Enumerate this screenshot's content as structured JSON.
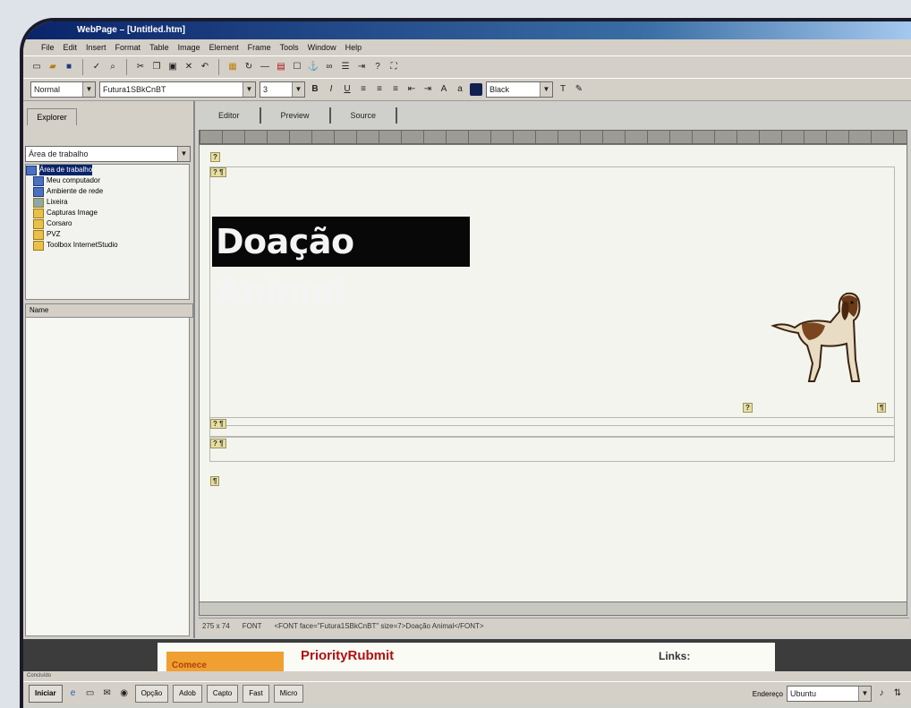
{
  "window": {
    "title": "WebPage – [Untitled.htm]"
  },
  "menu": [
    "File",
    "Edit",
    "Insert",
    "Format",
    "Table",
    "Image",
    "Element",
    "Frame",
    "Tools",
    "Window",
    "Help"
  ],
  "format_bar": {
    "style": "Normal",
    "font": "Futura1SBkCnBT",
    "size": "3",
    "color": "Black"
  },
  "explorer": {
    "tab_label": "Explorer",
    "folder_selected": "Área de trabalho",
    "tree": [
      {
        "label": "Área de trabalho",
        "selected": true,
        "icon": "desktop-icon"
      },
      {
        "label": "Meu computador",
        "icon": "computer-icon"
      },
      {
        "label": "Ambiente de rede",
        "icon": "network-icon"
      },
      {
        "label": "Lixeira",
        "icon": "recycle-bin-icon"
      },
      {
        "label": "Capturas Image",
        "icon": "folder-icon"
      },
      {
        "label": "Corsaro",
        "icon": "folder-icon"
      },
      {
        "label": "PVZ",
        "icon": "folder-icon"
      },
      {
        "label": "Toolbox InternetStudio",
        "icon": "folder-icon"
      }
    ],
    "name_header": "Name"
  },
  "view_tabs": [
    "Editor",
    "Preview",
    "Source"
  ],
  "page": {
    "headline": "Doação Animal",
    "marks": [
      "?",
      "? ¶",
      "?",
      "¶",
      "? ¶",
      "? ¶",
      "¶"
    ]
  },
  "status": {
    "size": "275 x 74",
    "tag": "FONT",
    "detail": "<FONT face=\"Futura1SBkCnBT\" size=7>Doação Animal</FONT>"
  },
  "browser": {
    "orange_text": "Comece",
    "title": "PriorityRubmit",
    "links": "Links:",
    "status": "Concluído"
  },
  "taskbar": {
    "start": "Iniciar",
    "buttons": [
      "Opção",
      "Adob",
      "Capto",
      "Fast",
      "Micro"
    ],
    "address_label": "Endereço",
    "address_value": "Ubuntu"
  }
}
